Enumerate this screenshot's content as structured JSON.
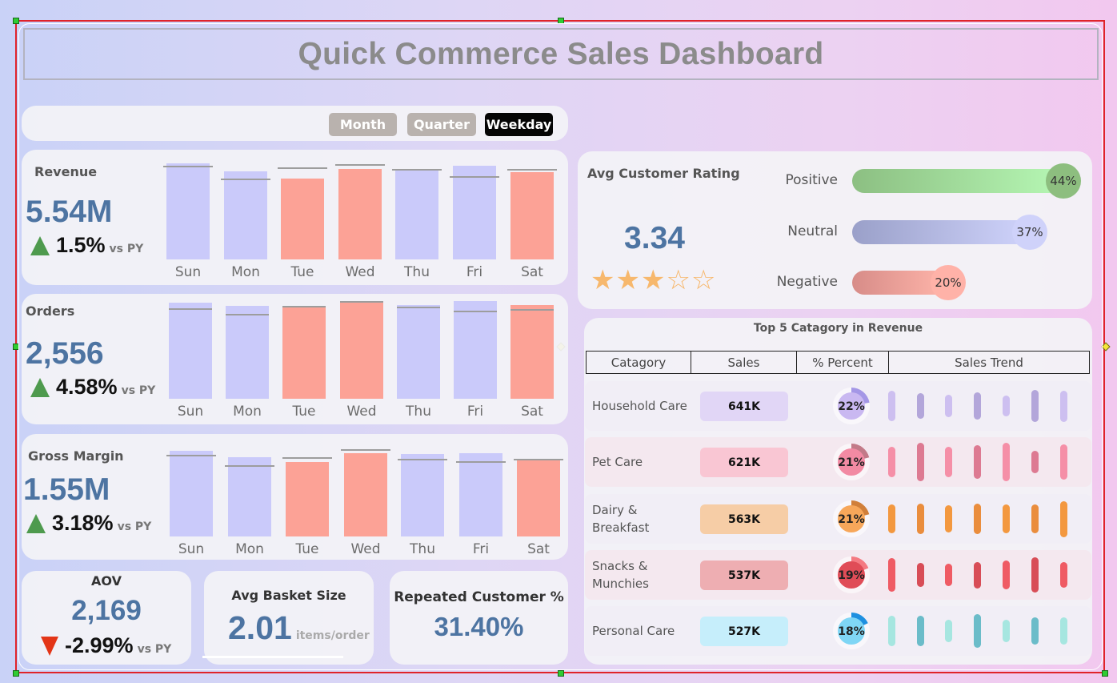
{
  "title": "Quick Commerce Sales Dashboard",
  "toggles": [
    "Month",
    "Quarter",
    "Weekday"
  ],
  "colors": {
    "bar_base": "#cacafa",
    "bar_highlight": "#fca296",
    "kpi_value": "#4d74a2",
    "up": "#4e9a4e",
    "down": "#e33517"
  },
  "days": [
    "Sun",
    "Mon",
    "Tue",
    "Wed",
    "Thu",
    "Fri",
    "Sat"
  ],
  "highlight_days": [
    "Tue",
    "Wed",
    "Sat"
  ],
  "revenue": {
    "label": "Revenue",
    "value": "5.54M",
    "change": "1.5%",
    "vs": "vs PY",
    "direction": "up"
  },
  "orders": {
    "label": "Orders",
    "value": "2,556",
    "change": "4.58%",
    "vs": "vs PY",
    "direction": "up"
  },
  "gross_margin": {
    "label": "Gross Margin",
    "value": "1.55M",
    "change": "3.18%",
    "vs": "vs PY",
    "direction": "up"
  },
  "aov": {
    "label": "AOV",
    "value": "2,169",
    "change": "-2.99%",
    "vs": "vs PY",
    "direction": "down"
  },
  "basket": {
    "label": "Avg Basket Size",
    "value": "2.01",
    "unit": "items/order"
  },
  "repeat": {
    "label": "Repeated Customer %",
    "value": "31.40%"
  },
  "rating": {
    "label": "Avg Customer Rating",
    "value": "3.34",
    "stars_filled": 3,
    "stars_total": 5,
    "sentiment": [
      {
        "label": "Positive",
        "percent": "44%",
        "share": 0.44,
        "color_from": "#8cbf82",
        "color_to": "#b6f7b4",
        "bubble": "#8dbe7f"
      },
      {
        "label": "Neutral",
        "percent": "37%",
        "share": 0.37,
        "color_from": "#9aa0c9",
        "color_to": "#cfd3fb",
        "bubble": "#cfd2fa"
      },
      {
        "label": "Negative",
        "percent": "20%",
        "share": 0.2,
        "color_from": "#d78c88",
        "color_to": "#ffb5aa",
        "bubble": "#ffb2a8"
      }
    ]
  },
  "categories_table": {
    "title": "Top 5 Catagory in Revenue",
    "headers": [
      "Catagory",
      "Sales",
      "% Percent",
      "Sales Trend"
    ],
    "rows": [
      {
        "name": [
          "Household Care"
        ],
        "sales": "641K",
        "percent": "22%",
        "share": 0.22,
        "pill": "#e1d6f6",
        "donut_fill": "#c9b8f1",
        "donut_arc": "#a497e6",
        "trend_color": "#cdbff0",
        "trend_color2": "#b3a6da",
        "band": "#f1eef6"
      },
      {
        "name": [
          "Pet Care"
        ],
        "sales": "621K",
        "percent": "21%",
        "share": 0.21,
        "pill": "#f9c6d3",
        "donut_fill": "#f28aa3",
        "donut_arc": "#c27a88",
        "trend_color": "#f58fa7",
        "trend_color2": "#dd7a92",
        "band": "#f4e8ef"
      },
      {
        "name": [
          "Dairy &",
          "Breakfast"
        ],
        "sales": "563K",
        "percent": "21%",
        "share": 0.21,
        "pill": "#f6cda6",
        "donut_fill": "#f7a75a",
        "donut_arc": "#d07f3a",
        "trend_color": "#f3983f",
        "trend_color2": "#ea8d3d",
        "band": "#f1eef6"
      },
      {
        "name": [
          "Snacks &",
          "Munchies"
        ],
        "sales": "537K",
        "percent": "19%",
        "share": 0.19,
        "pill": "#eeaeb2",
        "donut_fill": "#e04c57",
        "donut_arc": "#f47a82",
        "trend_color": "#ef5b64",
        "trend_color2": "#d84d57",
        "band": "#f4e8ef"
      },
      {
        "name": [
          "Personal Care"
        ],
        "sales": "527K",
        "percent": "18%",
        "share": 0.18,
        "pill": "#c6eefb",
        "donut_fill": "#7fd6f5",
        "donut_arc": "#1e90e0",
        "trend_color": "#a6e6e0",
        "trend_color2": "#6bbcc9",
        "band": "#f1eef6"
      }
    ]
  },
  "chart_data": [
    {
      "type": "bar",
      "title": "Revenue",
      "categories": [
        "Sun",
        "Mon",
        "Tue",
        "Wed",
        "Thu",
        "Fri",
        "Sat"
      ],
      "series": [
        {
          "values": [
            0.83,
            0.76,
            0.7,
            0.78,
            0.78,
            0.81,
            0.75
          ]
        },
        {
          "name": "PY",
          "values": [
            0.81,
            0.7,
            0.79,
            0.82,
            0.78,
            0.72,
            0.78
          ]
        }
      ],
      "ylim": [
        0,
        1
      ]
    },
    {
      "type": "bar",
      "title": "Orders",
      "categories": [
        "Sun",
        "Mon",
        "Tue",
        "Wed",
        "Thu",
        "Fri",
        "Sat"
      ],
      "series": [
        {
          "values": [
            0.83,
            0.8,
            0.79,
            0.83,
            0.81,
            0.84,
            0.81
          ]
        },
        {
          "name": "PY",
          "values": [
            0.78,
            0.73,
            0.8,
            0.84,
            0.79,
            0.76,
            0.77
          ]
        }
      ],
      "ylim": [
        0,
        1
      ]
    },
    {
      "type": "bar",
      "title": "Gross Margin",
      "categories": [
        "Sun",
        "Mon",
        "Tue",
        "Wed",
        "Thu",
        "Fri",
        "Sat"
      ],
      "series": [
        {
          "values": [
            0.75,
            0.69,
            0.65,
            0.73,
            0.72,
            0.73,
            0.68
          ]
        },
        {
          "name": "PY",
          "values": [
            0.71,
            0.62,
            0.69,
            0.76,
            0.68,
            0.66,
            0.68
          ]
        }
      ],
      "ylim": [
        0,
        1
      ]
    }
  ],
  "trends": [
    [
      0.63,
      0.52,
      0.46,
      0.56,
      0.42,
      0.66,
      0.65
    ],
    [
      0.64,
      0.8,
      0.63,
      0.69,
      0.8,
      0.47,
      0.73
    ],
    [
      0.6,
      0.64,
      0.57,
      0.64,
      0.59,
      0.6,
      0.75
    ],
    [
      0.71,
      0.5,
      0.47,
      0.55,
      0.59,
      0.73,
      0.54
    ],
    [
      0.62,
      0.62,
      0.48,
      0.7,
      0.48,
      0.56,
      0.56
    ]
  ]
}
